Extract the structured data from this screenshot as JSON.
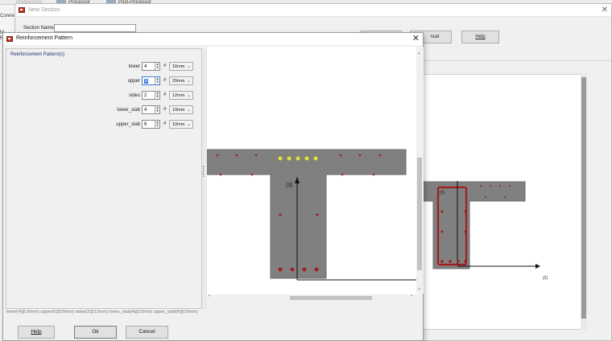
{
  "app": {
    "tabs": [
      {
        "label": "Preferences"
      },
      {
        "label": "Processor"
      },
      {
        "label": "Post-Processor"
      }
    ],
    "side_label": "Connec",
    "side_frag_1": "M",
    "side_frag_2": "R"
  },
  "new_section": {
    "title": "New Section",
    "section_name_label": "Section Name:",
    "section_name_value": "",
    "cancel_label": "ncel",
    "help_label": "Help",
    "axis_label_3": "(3)",
    "axis_label_2": "(2)"
  },
  "reinforcement": {
    "title": "Reinforcement Pattern",
    "group_label": "Reinforcement Pattern(s)",
    "hash_symbol": "#",
    "rows": [
      {
        "label": "lower",
        "count": "4",
        "size": "16mm"
      },
      {
        "label": "upper",
        "count": "5",
        "size": "20mm"
      },
      {
        "label": "sides",
        "count": "2",
        "size": "12mm"
      },
      {
        "label": "lower_slab",
        "count": "4",
        "size": "10mm"
      },
      {
        "label": "upper_slab",
        "count": "6",
        "size": "10mm"
      }
    ],
    "axis_label_3": "(3)",
    "status": "lower(4@16mm)  upper(5@20mm)  sides(2@12mm)  lower_slab(4@10mm)  upper_slab(6@10mm)",
    "help_label": "Help",
    "ok_label": "Ok",
    "cancel_label": "Cancel"
  },
  "colors": {
    "rebar": "#a21d1d",
    "rebar_highlight": "#e2dc5a",
    "section_fill": "#808080"
  },
  "icons": {
    "window": "section-app-icon",
    "close": "close-icon",
    "spin": "spin-arrows-icon",
    "dropdown": "chevron-down-icon"
  }
}
